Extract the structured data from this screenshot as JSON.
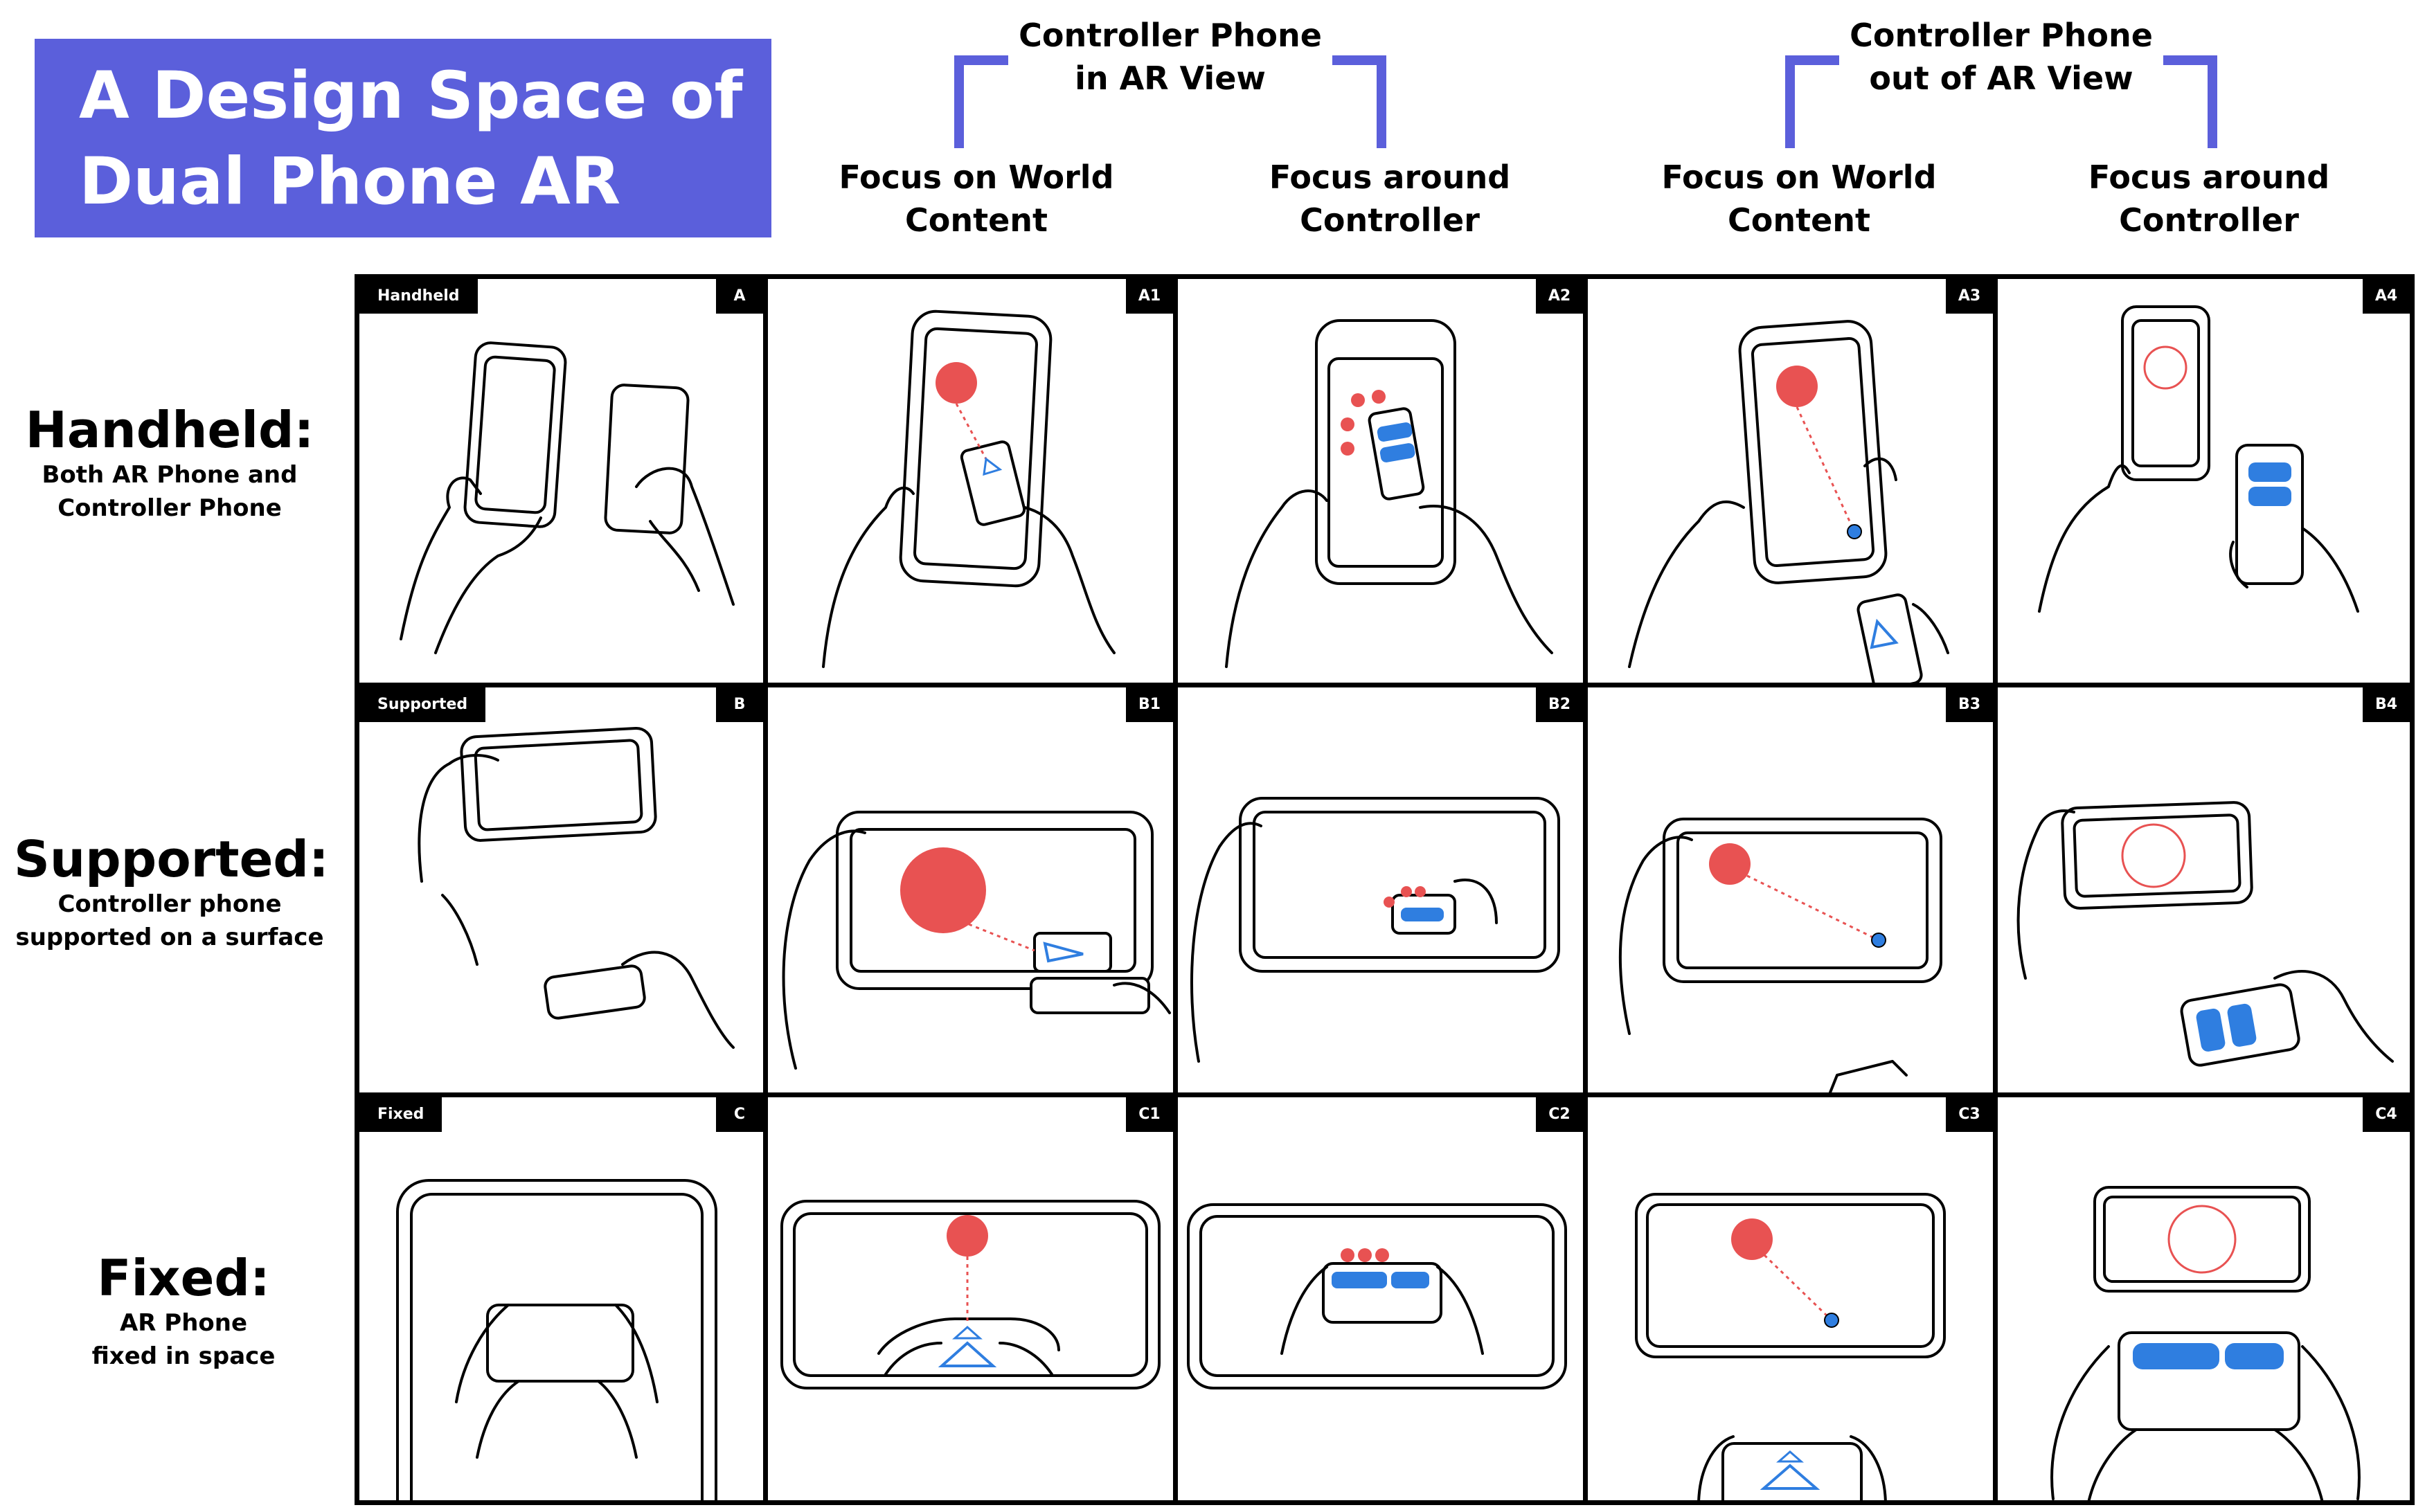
{
  "title": {
    "line1": "A Design Space of",
    "line2": "Dual Phone AR"
  },
  "colors": {
    "accent": "#5b5fdb",
    "target": "#e85252",
    "ui_blue": "#2f7ee0",
    "ink": "#000000"
  },
  "column_groups": [
    {
      "line1": "Controller Phone",
      "line2": "in AR View"
    },
    {
      "line1": "Controller Phone",
      "line2": "out of AR View"
    }
  ],
  "columns": [
    {
      "line1": "Focus on World",
      "line2": "Content"
    },
    {
      "line1": "Focus around",
      "line2": "Controller"
    },
    {
      "line1": "Focus on World",
      "line2": "Content"
    },
    {
      "line1": "Focus around",
      "line2": "Controller"
    }
  ],
  "rows": [
    {
      "title": "Handheld:",
      "sub1": "Both AR Phone and",
      "sub2": "Controller Phone"
    },
    {
      "title": "Supported:",
      "sub1": "Controller phone",
      "sub2": "supported on a surface"
    },
    {
      "title": "Fixed:",
      "sub1": "AR Phone",
      "sub2": "fixed in space"
    }
  ],
  "cells": [
    {
      "name": "Handheld",
      "id": "A"
    },
    {
      "name": "",
      "id": "A1"
    },
    {
      "name": "",
      "id": "A2"
    },
    {
      "name": "",
      "id": "A3"
    },
    {
      "name": "",
      "id": "A4"
    },
    {
      "name": "Supported",
      "id": "B"
    },
    {
      "name": "",
      "id": "B1"
    },
    {
      "name": "",
      "id": "B2"
    },
    {
      "name": "",
      "id": "B3"
    },
    {
      "name": "",
      "id": "B4"
    },
    {
      "name": "Fixed",
      "id": "C"
    },
    {
      "name": "",
      "id": "C1"
    },
    {
      "name": "",
      "id": "C2"
    },
    {
      "name": "",
      "id": "C3"
    },
    {
      "name": "",
      "id": "C4"
    }
  ]
}
